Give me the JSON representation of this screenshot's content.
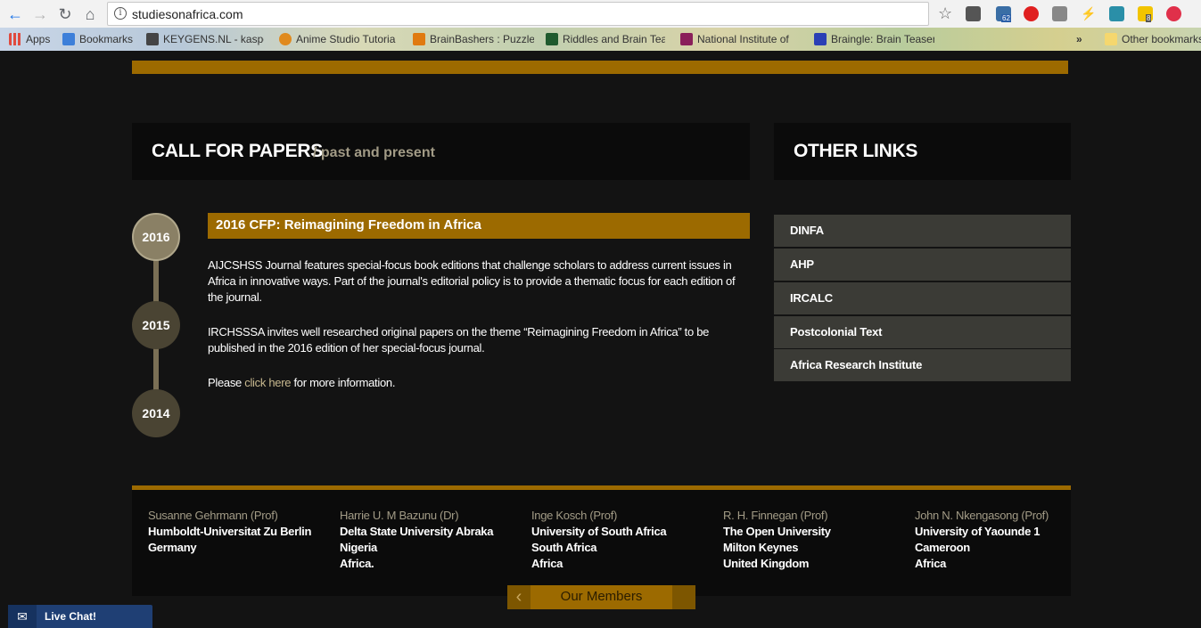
{
  "browser": {
    "url": "studiesonafrica.com",
    "bookmarks": [
      {
        "label": "Apps",
        "color": "#e04a3f"
      },
      {
        "label": "Bookmarks",
        "color": "#3d7fd9"
      },
      {
        "label": "KEYGENS.NL - kasper",
        "color": "#444444"
      },
      {
        "label": "Anime Studio Tutoria",
        "color": "#e08a1e"
      },
      {
        "label": "BrainBashers : Puzzles",
        "color": "#e07a10"
      },
      {
        "label": "Riddles and Brain Tea",
        "color": "#1f5a2e"
      },
      {
        "label": "National Institute of",
        "color": "#8a1f5a"
      },
      {
        "label": "Braingle: Brain Teaser",
        "color": "#2a3fb5"
      }
    ],
    "other_bookmarks": "Other bookmarks",
    "ext_badge_62": "62",
    "ext_badge_8": "8"
  },
  "cfp": {
    "title": "CALL FOR PAPERS",
    "subtitle": "/ past and present",
    "years": [
      "2016",
      "2015",
      "2014"
    ],
    "entry_title": "2016 CFP: Reimagining Freedom in Africa",
    "p1": "AIJCSHSS Journal features special-focus book editions that challenge scholars to address current issues in Africa in innovative ways. Part of the journal's editorial policy is to provide a thematic focus for each edition of the journal.",
    "p2": "IRCHSSSA invites well researched original papers on the theme “Reimagining Freedom in Africa” to be published in the 2016 edition of her special-focus journal.",
    "p3_before": "Please ",
    "p3_link": "click here",
    "p3_after": " for more information."
  },
  "other_links": {
    "title": "OTHER LINKS",
    "items": [
      "DINFA",
      "AHP",
      "IRCALC",
      "Postcolonial Text",
      "Africa Research Institute"
    ]
  },
  "members": [
    {
      "name": "Susanne Gehrmann (Prof)",
      "lines": [
        "Humboldt-Universitat Zu Berlin",
        "Germany"
      ]
    },
    {
      "name": "Harrie U. M Bazunu (Dr)",
      "lines": [
        "Delta State University Abraka",
        "Nigeria",
        "Africa."
      ]
    },
    {
      "name": "Inge Kosch (Prof)",
      "lines": [
        "University of South Africa",
        "South Africa",
        "Africa"
      ]
    },
    {
      "name": "R. H. Finnegan (Prof)",
      "lines": [
        "The Open University",
        "Milton Keynes",
        "United Kingdom"
      ]
    },
    {
      "name": "John N. Nkengasong (Prof)",
      "lines": [
        "University of Yaounde 1",
        "Cameroon",
        "Africa"
      ]
    }
  ],
  "our_members_label": "Our Members",
  "live_chat": "Live Chat!"
}
